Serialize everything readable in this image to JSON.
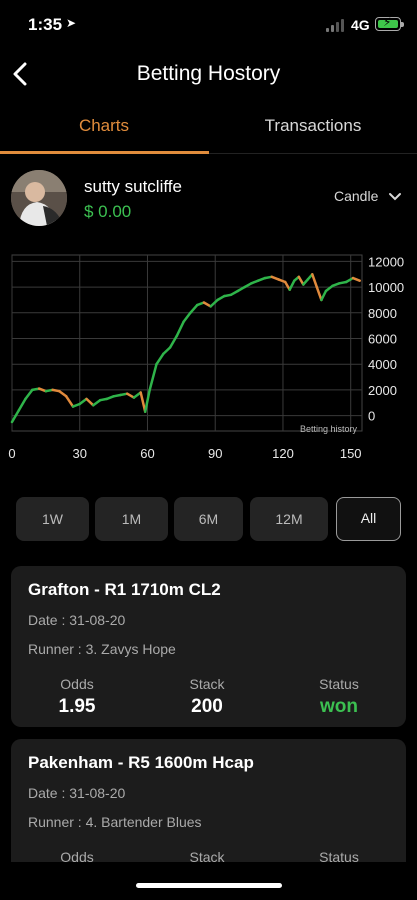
{
  "status_bar": {
    "time": "1:35",
    "network": "4G"
  },
  "header": {
    "title": "Betting Hostory"
  },
  "tabs": [
    {
      "label": "Charts",
      "active": true
    },
    {
      "label": "Transactions",
      "active": false
    }
  ],
  "profile": {
    "name": "sutty sutcliffe",
    "balance": "$ 0.00"
  },
  "chart_selector": {
    "value": "Candle"
  },
  "colors": {
    "accent": "#e08c3c",
    "positive": "#3cc051",
    "up_candle": "#2fb44a",
    "down_candle": "#e0893c"
  },
  "chart_data": {
    "type": "line",
    "title": "",
    "watermark": "Betting history",
    "xlabel": "",
    "ylabel": "",
    "x_ticks": [
      0,
      30,
      60,
      90,
      120,
      150
    ],
    "y_ticks": [
      12000,
      10000,
      8000,
      6000,
      4000,
      2000,
      0
    ],
    "xlim": [
      0,
      155
    ],
    "ylim": [
      -1200,
      12500
    ],
    "series": [
      {
        "x": [
          0,
          3,
          6,
          9,
          12,
          15,
          18,
          21,
          24,
          27,
          30,
          33,
          36,
          39,
          42,
          45,
          48,
          51,
          54,
          57,
          59,
          61,
          64,
          67,
          70,
          73,
          76,
          79,
          82,
          85,
          88,
          91,
          94,
          97,
          100,
          103,
          106,
          109,
          112,
          115,
          118,
          121,
          123,
          125,
          127,
          129,
          131,
          133,
          135,
          137,
          139,
          142,
          145,
          148,
          151,
          154
        ],
        "y": [
          -500,
          400,
          1300,
          2000,
          2100,
          1900,
          2000,
          1900,
          1500,
          700,
          900,
          1300,
          800,
          1200,
          1300,
          1500,
          1600,
          1700,
          1400,
          1800,
          300,
          2000,
          4000,
          4800,
          5300,
          6200,
          7300,
          8000,
          8600,
          8800,
          8500,
          9000,
          9300,
          9400,
          9700,
          10000,
          10300,
          10500,
          10700,
          10800,
          10600,
          10400,
          9800,
          10500,
          10800,
          10200,
          10600,
          11000,
          10000,
          9000,
          9700,
          10100,
          10300,
          10400,
          10700,
          10500
        ]
      }
    ]
  },
  "range_buttons": [
    {
      "label": "1W",
      "active": false
    },
    {
      "label": "1M",
      "active": false
    },
    {
      "label": "6M",
      "active": false
    },
    {
      "label": "12M",
      "active": false
    },
    {
      "label": "All",
      "active": true
    }
  ],
  "bets": [
    {
      "title": "Grafton - R1 1710m CL2",
      "date": "Date : 31-08-20",
      "runner": "Runner : 3. Zavys Hope",
      "odds_label": "Odds",
      "odds": "1.95",
      "stack_label": "Stack",
      "stack": "200",
      "status_label": "Status",
      "status": "won"
    },
    {
      "title": "Pakenham - R5 1600m Hcap",
      "date": "Date : 31-08-20",
      "runner": "Runner : 4. Bartender Blues",
      "odds_label": "Odds",
      "odds": "",
      "stack_label": "Stack",
      "stack": "",
      "status_label": "Status",
      "status": ""
    }
  ]
}
